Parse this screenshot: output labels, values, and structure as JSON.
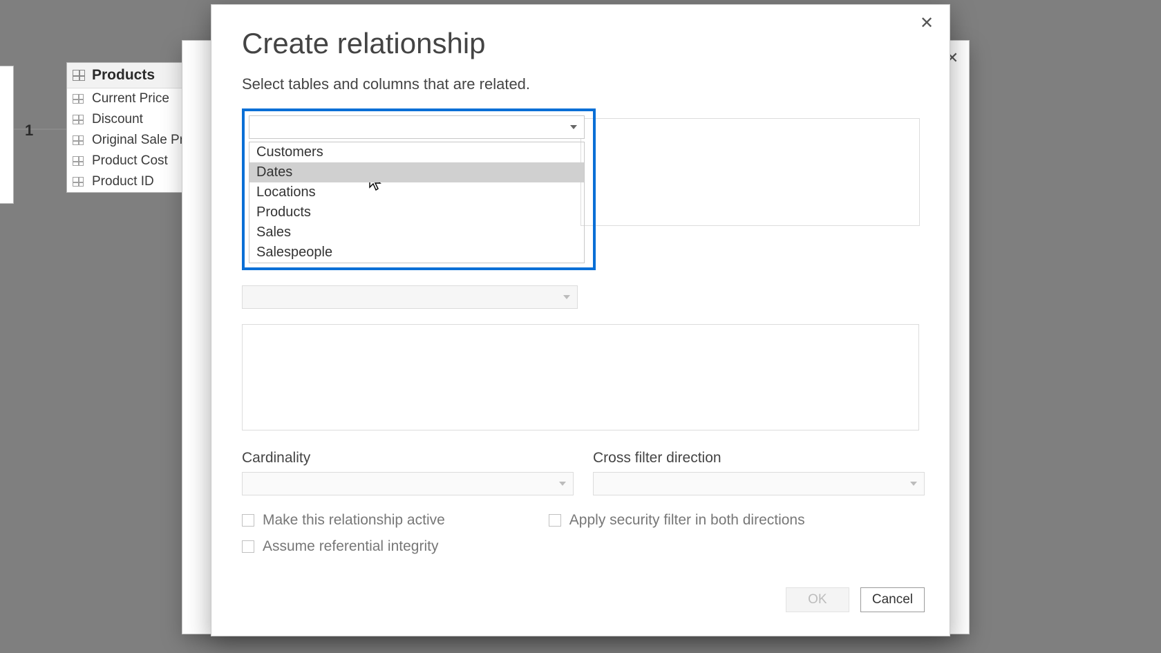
{
  "workspace": {
    "mini_one_label": "1",
    "products_card": {
      "title": "Products",
      "fields": [
        "Current Price",
        "Discount",
        "Original Sale Pri",
        "Product Cost",
        "Product ID"
      ]
    }
  },
  "dialog": {
    "title": "Create relationship",
    "subtitle": "Select tables and columns that are related.",
    "table_dropdown": {
      "options": [
        "Customers",
        "Dates",
        "Locations",
        "Products",
        "Sales",
        "Salespeople"
      ],
      "hovered_index": 1
    },
    "cardinality_label": "Cardinality",
    "crossfilter_label": "Cross filter direction",
    "check_active": "Make this relationship active",
    "check_security": "Apply security filter in both directions",
    "check_referential": "Assume referential integrity",
    "ok_label": "OK",
    "cancel_label": "Cancel"
  }
}
